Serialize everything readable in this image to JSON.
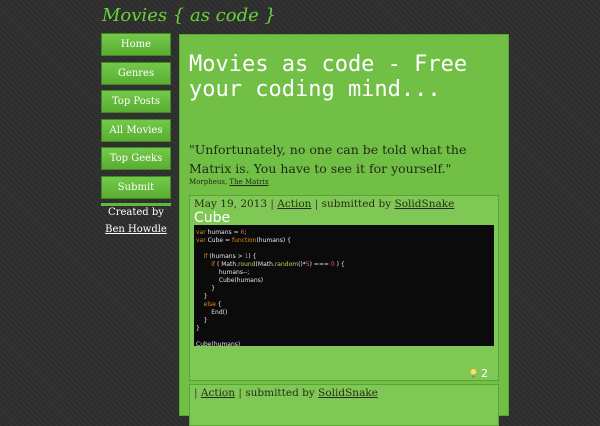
{
  "site": {
    "title": "Movies { as code }"
  },
  "nav": {
    "items": [
      {
        "label": "Home"
      },
      {
        "label": "Genres"
      },
      {
        "label": "Top Posts"
      },
      {
        "label": "All Movies"
      },
      {
        "label": "Top Geeks"
      },
      {
        "label": "Submit"
      }
    ]
  },
  "sidebar": {
    "created_by": "Created by",
    "author": "Ben Howdle"
  },
  "main": {
    "heading": "Movies as code - Free your coding mind...",
    "quote": "\"Unfortunately, no one can be told what the Matrix is. You have to see it for yourself.\"",
    "attribution_name": "Morpheus,",
    "attribution_movie": "The Matrix"
  },
  "posts": [
    {
      "date": "May 19, 2013",
      "sep1": "|",
      "genre": "Action",
      "sep2": "|",
      "submitted_by": "submitted by",
      "author": "SolidSnake",
      "title": "Cube",
      "code_lines": [
        "var humans = 6;",
        "var Cube = function(humans) {",
        "",
        "    if (humans > 1) {",
        "        if ( Math.round(Math.random()*5) === 0 ) {",
        "            humans--;",
        "            Cube(humans)",
        "        }",
        "    }",
        "    else {",
        "        End()",
        "    }",
        "}",
        "",
        "Cube(humans)"
      ],
      "likes": "2",
      "like_icon": "lightbulb-icon"
    },
    {
      "sep1": "|",
      "genre": "Action",
      "sep2": "|",
      "submitted_by": "submitted by",
      "author": "SolidSnake"
    }
  ]
}
